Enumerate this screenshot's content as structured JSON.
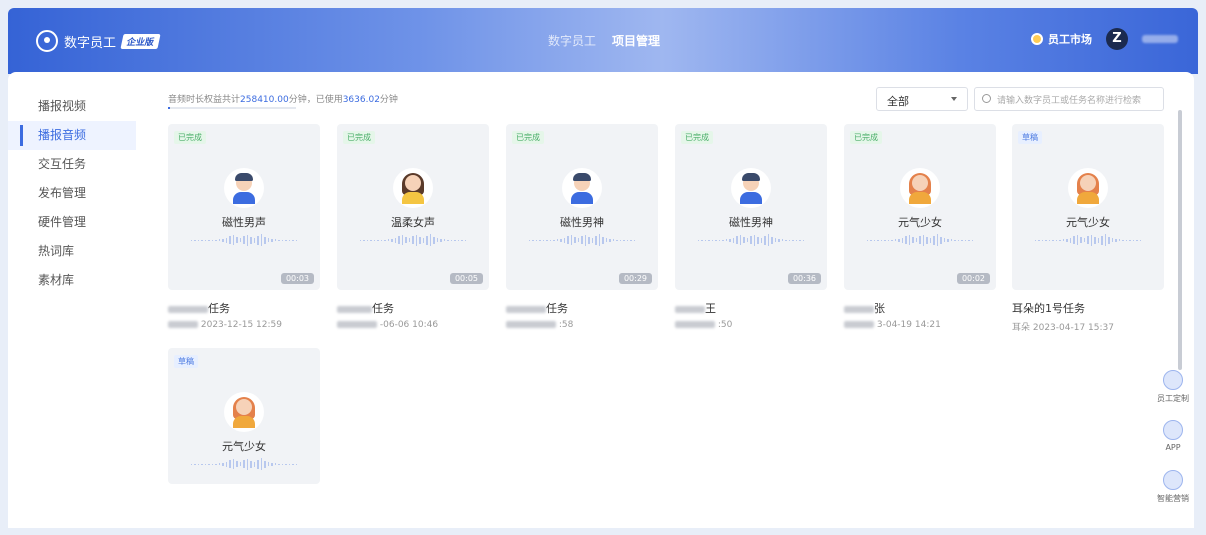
{
  "header": {
    "app_name": "数字员工",
    "edition_badge": "企业版",
    "nav": [
      {
        "label": "数字员工",
        "active": false
      },
      {
        "label": "项目管理",
        "active": true
      }
    ],
    "market_label": "员工市场",
    "avatar_letter": "Z"
  },
  "sidebar": {
    "items": [
      {
        "label": "播报视频",
        "active": false
      },
      {
        "label": "播报音频",
        "active": true
      },
      {
        "label": "交互任务",
        "active": false
      },
      {
        "label": "发布管理",
        "active": false
      },
      {
        "label": "硬件管理",
        "active": false
      },
      {
        "label": "热词库",
        "active": false
      },
      {
        "label": "素材库",
        "active": false
      }
    ]
  },
  "quota": {
    "prefix": "音频时长权益共计",
    "total": "258410.00",
    "unit1": "分钟，已使用",
    "used": "3636.02",
    "unit2": "分钟",
    "used_fraction": 0.014
  },
  "filter": {
    "selected": "全部"
  },
  "search": {
    "placeholder": "请输入数字员工或任务名称进行检索"
  },
  "cards": [
    {
      "status": "已完成",
      "status_type": "done",
      "voice": "磁性男声",
      "avatar": "male",
      "duration": "00:03",
      "title": "任务",
      "meta": "2023-12-15 12:59"
    },
    {
      "status": "已完成",
      "status_type": "done",
      "voice": "温柔女声",
      "avatar": "female2",
      "duration": "00:05",
      "title": "任务",
      "meta": "-06-06 10:46"
    },
    {
      "status": "已完成",
      "status_type": "done",
      "voice": "磁性男神",
      "avatar": "male",
      "duration": "00:29",
      "title": "任务",
      "meta": ":58"
    },
    {
      "status": "已完成",
      "status_type": "done",
      "voice": "磁性男神",
      "avatar": "male",
      "duration": "00:36",
      "title": "王",
      "meta": ":50"
    },
    {
      "status": "已完成",
      "status_type": "done",
      "voice": "元气少女",
      "avatar": "female",
      "duration": "00:02",
      "title": "张",
      "meta": "3-04-19 14:21"
    },
    {
      "status": "草稿",
      "status_type": "draft",
      "voice": "元气少女",
      "avatar": "female",
      "duration": "",
      "title": "耳朵的1号任务",
      "meta": "耳朵 2023-04-17 15:37"
    },
    {
      "status": "草稿",
      "status_type": "draft",
      "voice": "元气少女",
      "avatar": "female",
      "duration": "",
      "title": "",
      "meta": ""
    }
  ],
  "float_panel": [
    {
      "label": "员工定制",
      "icon": "user-custom-icon"
    },
    {
      "label": "APP",
      "icon": "mobile-app-icon"
    },
    {
      "label": "智能营销",
      "icon": "marketing-chart-icon"
    }
  ]
}
